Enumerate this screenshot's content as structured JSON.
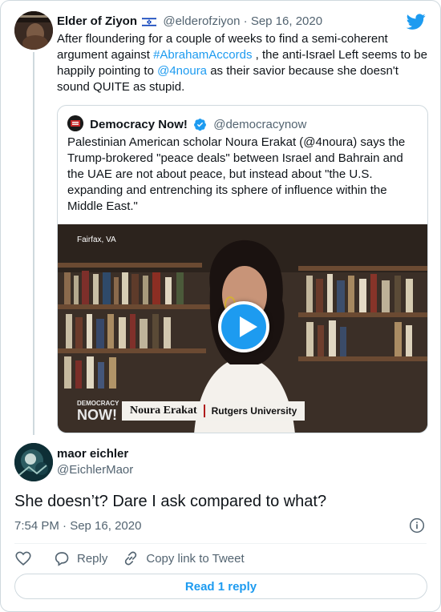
{
  "parent_tweet": {
    "author_name": "Elder of Ziyon",
    "author_handle": "@elderofziyon",
    "date": "Sep 16, 2020",
    "text_1": "After floundering for a couple of weeks to find a semi-coherent argument against ",
    "hashtag": "#AbrahamAccords",
    "text_2": " , the anti-Israel Left seems to be happily pointing to ",
    "mention": "@4noura",
    "text_3": " as their savior because she doesn't sound QUITE as stupid."
  },
  "quoted_tweet": {
    "author_name": "Democracy Now!",
    "author_handle": "@democracynow",
    "text": "Palestinian American scholar Noura Erakat (@4noura) says the Trump-brokered \"peace deals\" between Israel and Bahrain and the UAE are not about peace, but instead about \"the U.S. expanding and entrenching its sphere of influence within the Middle East.\"",
    "video": {
      "location": "Fairfax, VA",
      "logo_line1": "DEMOCRACY",
      "logo_line2": "NOW!",
      "guest_name": "Noura Erakat",
      "guest_affiliation": "Rutgers University"
    }
  },
  "reply": {
    "author_name": "maor eichler",
    "author_handle": "@EichlerMaor",
    "text": "She doesn’t? Dare I ask compared to what?",
    "timestamp": "7:54 PM · Sep 16, 2020"
  },
  "actions": {
    "reply_label": "Reply",
    "copy_label": "Copy link to Tweet",
    "read_replies_label": "Read 1 reply"
  },
  "icons": [
    "twitter-logo-icon",
    "israel-flag-icon",
    "verified-badge-icon",
    "play-icon",
    "info-icon",
    "heart-icon",
    "reply-icon",
    "link-icon"
  ],
  "colors": {
    "accent": "#1d9bf0",
    "text": "#0f1419",
    "muted": "#536471",
    "border": "#cfd9de"
  }
}
